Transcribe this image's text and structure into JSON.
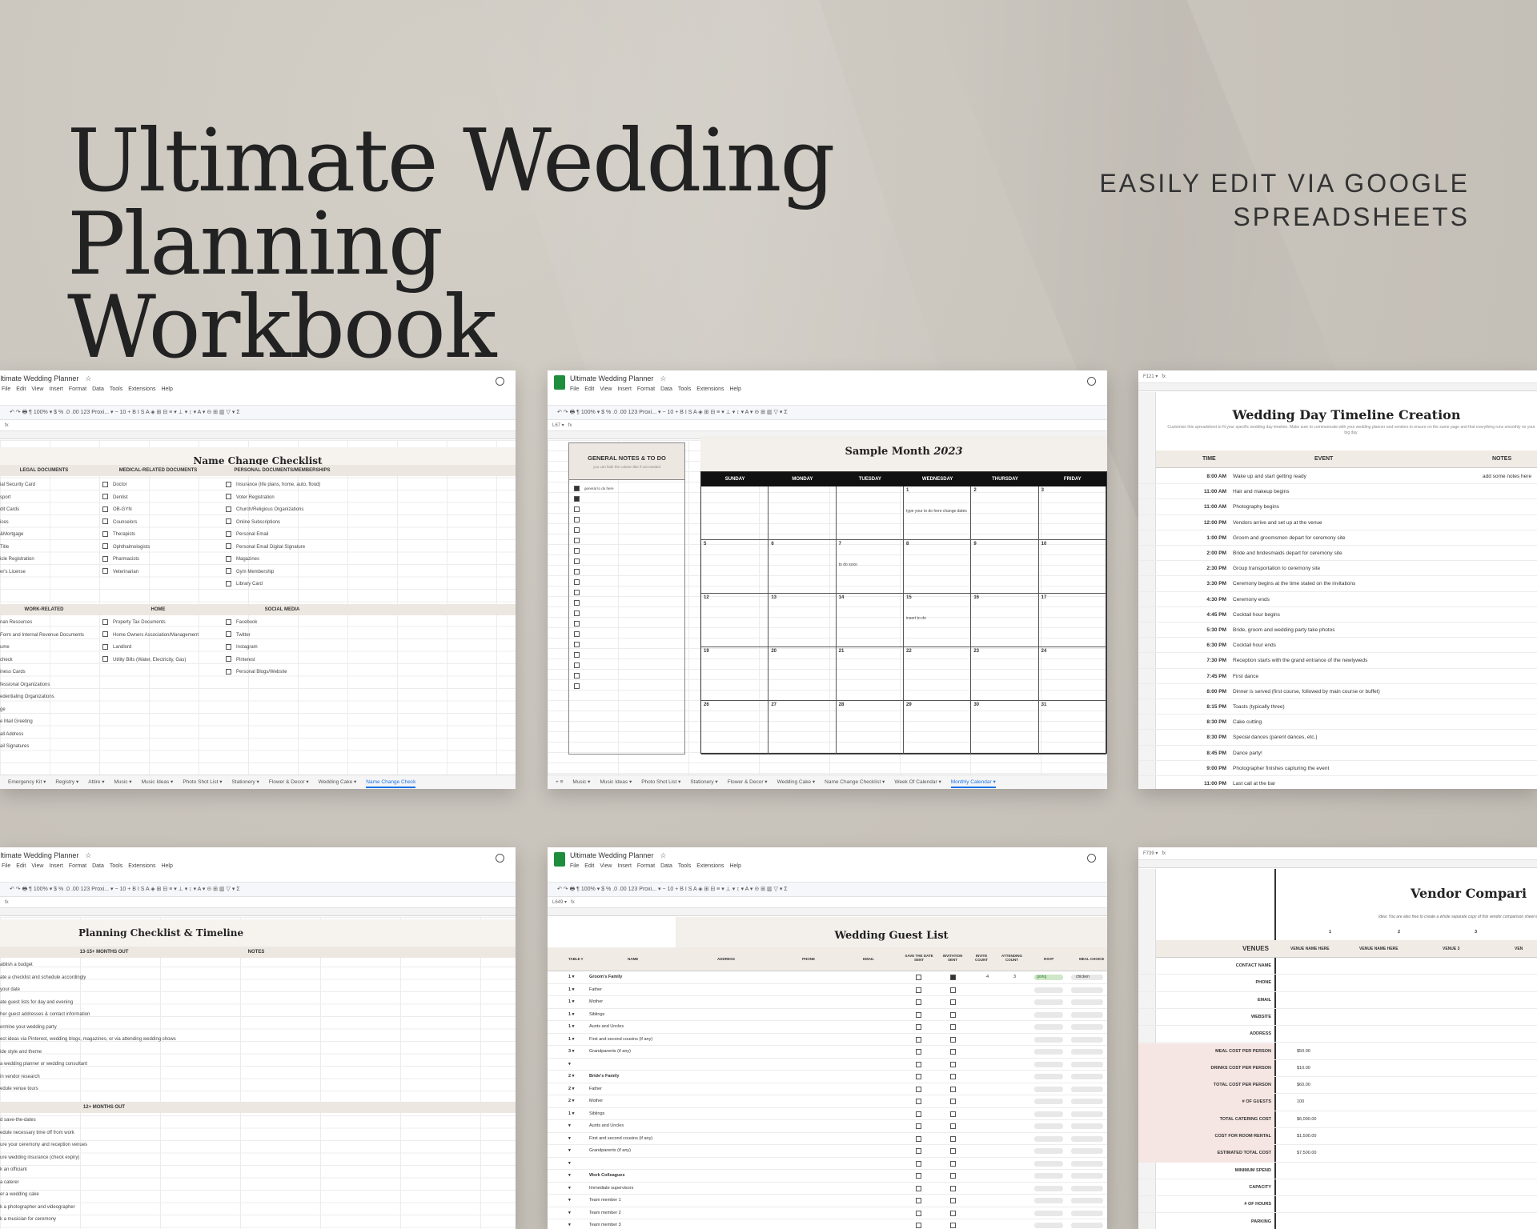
{
  "hero": {
    "title_line1": "Ultimate Wedding",
    "title_line2": "Planning Workbook",
    "subtitle_line1": "EASILY EDIT VIA GOOGLE",
    "subtitle_line2": "SPREADSHEETS"
  },
  "common": {
    "doc_title": "Ultimate Wedding Planner",
    "menu": [
      "File",
      "Edit",
      "View",
      "Insert",
      "Format",
      "Data",
      "Tools",
      "Extensions",
      "Help"
    ],
    "toolbar": "↶  ↷  🖶  ¶   100% ▾   $  %  .0  .00  123   Proxi... ▾   −  10  +   B  I  S  A   ◈  ⊞  ⊟   ≡ ▾  ⊥ ▾  ↕ ▾  A ▾   ⊝  ⊞  ▥  ▽ ▾  Σ"
  },
  "panel1": {
    "title": "Name Change Checklist",
    "col1_head": "LEGAL DOCUMENTS",
    "col2_head": "MEDICAL-RELATED DOCUMENTS",
    "col3_head": "PERSONAL DOCUMENTS/MEMBERSHIPS",
    "col1": [
      "ial Security Card",
      "sport",
      "dit Cards",
      "ices",
      "&Mortgage",
      "Title",
      "icle Registration",
      "er's License"
    ],
    "col2": [
      "Doctor",
      "Dentist",
      "OB-GYN",
      "Counselors",
      "Therapists",
      "Ophthalmologists",
      "Pharmacists",
      "Veterinarian"
    ],
    "col3": [
      "Insurance (life plans, home, auto, flood)",
      "Voter Registration",
      "Church/Religious Organizations",
      "Online Subscriptions",
      "Personal Email",
      "Personal Email Digital Signature",
      "Magazines",
      "Gym Membership",
      "Library Card"
    ],
    "col1b_head": "WORK-RELATED",
    "col2b_head": "HOME",
    "col3b_head": "SOCIAL MEDIA",
    "col1b": [
      "nan Resources",
      "Form and Internal Revenue Documents",
      "ume",
      "check",
      "iness Cards",
      "fessional Organizations",
      "edentialing Organizations",
      "ge",
      "e Mail Greeting",
      "all Address",
      "ail Signatures"
    ],
    "col2b": [
      "Property Tax Documents",
      "Home Owners Association/Management",
      "Landlord",
      "Utility Bills (Water, Electricity, Gas)"
    ],
    "col3b": [
      "Facebook",
      "Twitter",
      "Instagram",
      "Pinterest",
      "Personal Blogs/Website"
    ],
    "tabs": [
      "Emergency Kit ▾",
      "Registry ▾",
      "Attire ▾",
      "Music ▾",
      "Music Ideas ▾",
      "Photo Shot List ▾",
      "Stationery ▾",
      "Flower & Decor ▾",
      "Wedding Cake ▾",
      "Name Change Check"
    ]
  },
  "panel2": {
    "title_main": "Sample Month",
    "title_year": "2023",
    "notes_head": "GENERAL NOTES & TO DO",
    "notes_sub": "you can hide the column like if not needed",
    "notes_items": [
      "general to do here",
      "",
      "",
      "",
      "",
      "",
      "",
      "",
      "",
      "",
      "",
      "",
      "",
      "",
      "",
      "",
      "",
      "",
      "",
      ""
    ],
    "days": [
      "SUNDAY",
      "MONDAY",
      "TUESDAY",
      "WEDNESDAY",
      "THURSDAY",
      "FRIDAY"
    ],
    "cells": [
      {
        "d": "",
        "n": ""
      },
      {
        "d": "",
        "n": ""
      },
      {
        "d": "",
        "n": ""
      },
      {
        "d": "1",
        "n": "type your to do here change dates"
      },
      {
        "d": "2",
        "n": ""
      },
      {
        "d": "3",
        "n": ""
      },
      {
        "d": "5",
        "n": ""
      },
      {
        "d": "6",
        "n": ""
      },
      {
        "d": "7",
        "n": "to do xoxo"
      },
      {
        "d": "8",
        "n": ""
      },
      {
        "d": "9",
        "n": ""
      },
      {
        "d": "10",
        "n": ""
      },
      {
        "d": "12",
        "n": ""
      },
      {
        "d": "13",
        "n": ""
      },
      {
        "d": "14",
        "n": ""
      },
      {
        "d": "15",
        "n": "insert to do"
      },
      {
        "d": "16",
        "n": ""
      },
      {
        "d": "17",
        "n": ""
      },
      {
        "d": "19",
        "n": ""
      },
      {
        "d": "20",
        "n": ""
      },
      {
        "d": "21",
        "n": ""
      },
      {
        "d": "22",
        "n": ""
      },
      {
        "d": "23",
        "n": ""
      },
      {
        "d": "24",
        "n": ""
      },
      {
        "d": "26",
        "n": ""
      },
      {
        "d": "27",
        "n": ""
      },
      {
        "d": "28",
        "n": ""
      },
      {
        "d": "29",
        "n": ""
      },
      {
        "d": "30",
        "n": ""
      },
      {
        "d": "31",
        "n": ""
      }
    ],
    "tabs": [
      "+  ≡",
      "Music ▾",
      "Music Ideas ▾",
      "Photo Shot List ▾",
      "Stationery ▾",
      "Flower & Decor ▾",
      "Wedding Cake ▾",
      "Name Change Checklist ▾",
      "Week Of Calendar ▾",
      "Monthly Calendar ▾"
    ]
  },
  "panel3": {
    "cellref": "F121",
    "title": "Wedding Day Timeline Creation",
    "intro": "Customize this spreadsheet to fit your specific wedding day timeline. Make sure to communicate with your wedding planner and vendors to ensure on the same page and that everything runs smoothly on your big day.",
    "h_time": "TIME",
    "h_event": "EVENT",
    "h_notes": "NOTES",
    "rows": [
      {
        "t": "8:00 AM",
        "e": "Wake up and start getting ready",
        "n": "add some notes here"
      },
      {
        "t": "11:00 AM",
        "e": "Hair and makeup begins",
        "n": ""
      },
      {
        "t": "11:00 AM",
        "e": "Photography begins",
        "n": ""
      },
      {
        "t": "12:00 PM",
        "e": "Vendors arrive and set up at the venue",
        "n": ""
      },
      {
        "t": "1:00 PM",
        "e": "Groom and groomsmen depart for ceremony site",
        "n": ""
      },
      {
        "t": "2:00 PM",
        "e": "Bride and bridesmaids depart for ceremony site",
        "n": ""
      },
      {
        "t": "2:30 PM",
        "e": "Group transportation to ceremony site",
        "n": ""
      },
      {
        "t": "3:30 PM",
        "e": "Ceremony begins at the time stated on the invitations",
        "n": ""
      },
      {
        "t": "4:30 PM",
        "e": "Ceremony ends",
        "n": ""
      },
      {
        "t": "4:45 PM",
        "e": "Cocktail hour begins",
        "n": ""
      },
      {
        "t": "5:30 PM",
        "e": "Bride, groom and wedding party take photos",
        "n": ""
      },
      {
        "t": "6:30 PM",
        "e": "Cocktail hour ends",
        "n": ""
      },
      {
        "t": "7:30 PM",
        "e": "Reception starts with the grand entrance of the newlyweds",
        "n": ""
      },
      {
        "t": "7:45 PM",
        "e": "First dance",
        "n": ""
      },
      {
        "t": "8:00 PM",
        "e": "Dinner is served (first course, followed by main course or buffet)",
        "n": ""
      },
      {
        "t": "8:15 PM",
        "e": "Toasts (typically three)",
        "n": ""
      },
      {
        "t": "8:30 PM",
        "e": "Cake cutting",
        "n": ""
      },
      {
        "t": "8:30 PM",
        "e": "Special dances (parent dances, etc.)",
        "n": ""
      },
      {
        "t": "8:45 PM",
        "e": "Dance party!",
        "n": ""
      },
      {
        "t": "9:00 PM",
        "e": "Photographer finishes capturing the event",
        "n": ""
      },
      {
        "t": "11:00 PM",
        "e": "Last call at the bar",
        "n": ""
      }
    ]
  },
  "panel4": {
    "title": "Planning Checklist & Timeline",
    "sec1": "13-15+ MONTHS OUT",
    "notes": "NOTES",
    "list1": [
      "ablish a budget",
      "ate a checklist and schedule accordingly",
      "your date",
      "ate guest lists for day and evening",
      "her guest addresses & contact information",
      "ermine your wedding party",
      "ect ideas via Pinterest, wedding blogs, magazines, or via attending wedding shows",
      "ide style and theme",
      "a wedding planner or wedding consultant",
      "in vendor research",
      "edule venue tours"
    ],
    "sec2": "12+ MONTHS OUT",
    "list2": [
      "d save-the-dates",
      "edule necessary time off from work",
      "ure your ceremony and reception venues",
      "ure wedding insurance (check expiry)",
      "k an officiant",
      "a caterer",
      "er a wedding cake",
      "k a photographer and videographer",
      "k a musician for ceremony",
      "k a band and/or DJ for reception"
    ]
  },
  "panel5": {
    "cellref": "L649",
    "title": "Wedding Guest List",
    "h_table": "TABLE #",
    "h_name": "NAME",
    "h_address": "ADDRESS",
    "h_phone": "PHONE",
    "h_email": "EMAIL",
    "h_std": "SAVE THE DATE SENT",
    "h_inv": "INVITATION SENT",
    "h_invcount": "INVITE COUNT",
    "h_attcount": "ATTENDING COUNT",
    "h_rsvp": "RSVP",
    "h_meal": "MEAL CHOICE",
    "going": "going",
    "chicken": "chicken",
    "invite_count": "4",
    "attending_count": "3",
    "rows": [
      {
        "tbl": "1 ▾",
        "nm": "Groom's Family",
        "b": true
      },
      {
        "tbl": "1 ▾",
        "nm": "Father",
        "b": false
      },
      {
        "tbl": "1 ▾",
        "nm": "Mother",
        "b": false
      },
      {
        "tbl": "1 ▾",
        "nm": "Siblings",
        "b": false
      },
      {
        "tbl": "1 ▾",
        "nm": "Aunts and Uncles",
        "b": false
      },
      {
        "tbl": "1 ▾",
        "nm": "First and second cousins (if any)",
        "b": false
      },
      {
        "tbl": "3 ▾",
        "nm": "Grandparents (if any)",
        "b": false
      },
      {
        "tbl": "▾",
        "nm": "",
        "b": false
      },
      {
        "tbl": "2 ▾",
        "nm": "Bride's Family",
        "b": true
      },
      {
        "tbl": "2 ▾",
        "nm": "Father",
        "b": false
      },
      {
        "tbl": "2 ▾",
        "nm": "Mother",
        "b": false
      },
      {
        "tbl": "1 ▾",
        "nm": "Siblings",
        "b": false
      },
      {
        "tbl": "▾",
        "nm": "Aunts and Uncles",
        "b": false
      },
      {
        "tbl": "▾",
        "nm": "First and second cousins (if any)",
        "b": false
      },
      {
        "tbl": "▾",
        "nm": "Grandparents (if any)",
        "b": false
      },
      {
        "tbl": "▾",
        "nm": "",
        "b": false
      },
      {
        "tbl": "▾",
        "nm": "Work Colleagues",
        "b": true
      },
      {
        "tbl": "▾",
        "nm": "Immediate supervisors",
        "b": false
      },
      {
        "tbl": "▾",
        "nm": "Team member 1",
        "b": false
      },
      {
        "tbl": "▾",
        "nm": "Team member 2",
        "b": false
      },
      {
        "tbl": "▾",
        "nm": "Team member 3",
        "b": false
      }
    ]
  },
  "panel6": {
    "cellref": "F739",
    "title": "Vendor Compari",
    "note": "Idea: You are also free to create a whole separate copy of this vendor comparison sheet if th",
    "nums": [
      "1",
      "2",
      "3"
    ],
    "venues_label": "VENUES",
    "venue_names": [
      "VENUE NAME HERE",
      "VENUE NAME HERE",
      "VENUE 3",
      "VEN"
    ],
    "rows": [
      {
        "lbl": "CONTACT NAME",
        "val": "",
        "pink": false
      },
      {
        "lbl": "PHONE",
        "val": "",
        "pink": false
      },
      {
        "lbl": "EMAIL",
        "val": "",
        "pink": false
      },
      {
        "lbl": "WEBSITE",
        "val": "",
        "pink": false
      },
      {
        "lbl": "ADDRESS",
        "val": "",
        "pink": false
      },
      {
        "lbl": "MEAL COST PER PERSON",
        "val": "$50.00",
        "pink": true
      },
      {
        "lbl": "DRINKS COST PER PERSON",
        "val": "$10.00",
        "pink": true
      },
      {
        "lbl": "TOTAL COST PER PERSON",
        "val": "$60.00",
        "pink": true
      },
      {
        "lbl": "# OF GUESTS",
        "val": "100",
        "pink": true
      },
      {
        "lbl": "TOTAL CATERING COST",
        "val": "$6,000.00",
        "pink": true
      },
      {
        "lbl": "COST FOR ROOM RENTAL",
        "val": "$1,500.00",
        "pink": true
      },
      {
        "lbl": "ESTIMATED TOTAL COST",
        "val": "$7,500.00",
        "pink": true
      },
      {
        "lbl": "MINIMUM SPEND",
        "val": "",
        "pink": false
      },
      {
        "lbl": "CAPACITY",
        "val": "",
        "pink": false
      },
      {
        "lbl": "# OF HOURS",
        "val": "",
        "pink": false
      },
      {
        "lbl": "PARKING",
        "val": "",
        "pink": false
      }
    ]
  }
}
